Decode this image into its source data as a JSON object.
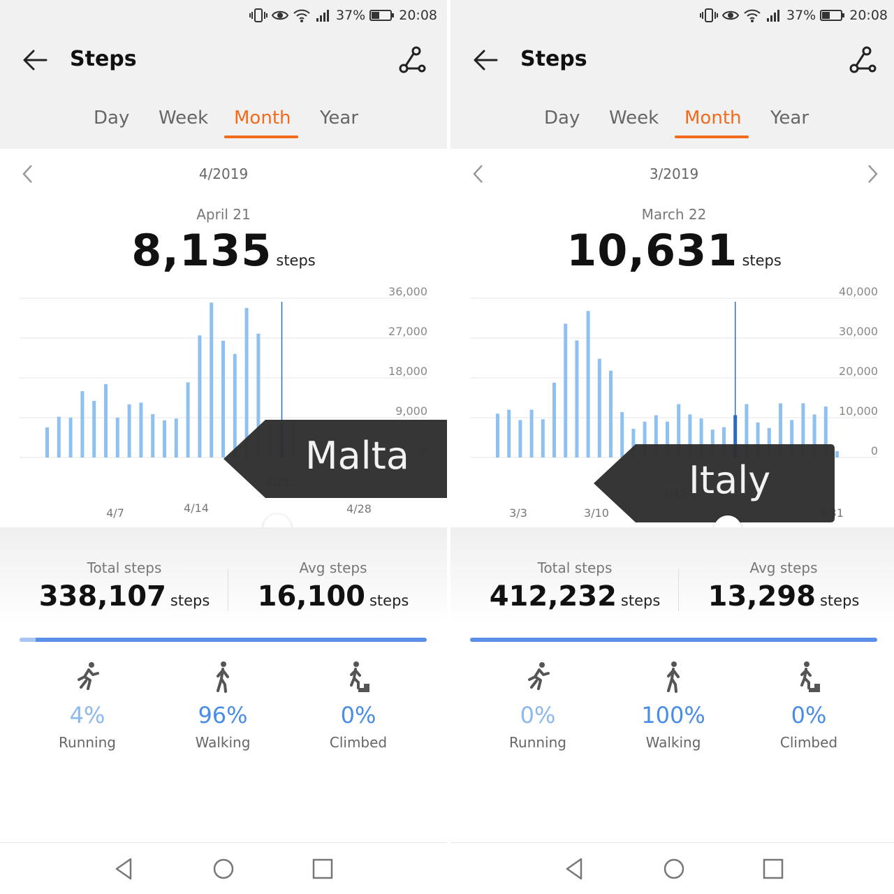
{
  "colors": {
    "accent": "#f26a1b",
    "bar": "#8ec0f2",
    "bar_selected": "#2a6cc2",
    "circle": "#f08c35",
    "ribbon": "#2f2f2f",
    "progress": "#5b8ee6",
    "pct_light": "#8cb8ee",
    "pct_strong": "#4a8de6"
  },
  "status_bar": {
    "battery": "37%",
    "time": "20:08",
    "icons": [
      "vibrate-icon",
      "eye-icon",
      "wifi-icon",
      "signal-icon",
      "battery-icon"
    ]
  },
  "panels": [
    {
      "header": {
        "title": "Steps",
        "back_icon": "back-arrow-icon",
        "route_icon": "route-icon"
      },
      "tabs": [
        {
          "label": "Day"
        },
        {
          "label": "Week"
        },
        {
          "label": "Month"
        },
        {
          "label": "Year"
        }
      ],
      "active_tab": "Month",
      "period": "4/2019",
      "has_next": false,
      "selected": {
        "date": "April 21",
        "value": "8,135",
        "unit": "steps"
      },
      "chart_data": {
        "type": "bar",
        "y_ticks": [
          "36,000",
          "27,000",
          "18,000",
          "9,000",
          "0"
        ],
        "ylim": [
          0,
          36000
        ],
        "x_tick_labels": [
          "4/7",
          "4/14",
          "4/21",
          "4/28"
        ],
        "selected_index": 20,
        "values": [
          6800,
          9200,
          9000,
          15000,
          12800,
          16600,
          9000,
          12000,
          12400,
          9800,
          8400,
          8800,
          17000,
          27600,
          35000,
          26400,
          23400,
          33800,
          28000,
          7400,
          7400,
          8135
        ],
        "series": [
          {
            "values": [
              6800,
              9200,
              9000,
              15000,
              12800,
              16600,
              9000,
              12000,
              12400,
              9800,
              8400,
              8800,
              17000,
              27600,
              35000,
              26400,
              23400,
              33800,
              28000,
              7400,
              7400,
              8135
            ]
          }
        ]
      },
      "annotation": "Malta",
      "totals": {
        "total_label": "Total steps",
        "total_value": "338,107",
        "avg_label": "Avg steps",
        "avg_value": "16,100",
        "unit": "steps"
      },
      "activities": [
        {
          "pct": "4%",
          "label": "Running",
          "icon": "running-icon"
        },
        {
          "pct": "96%",
          "label": "Walking",
          "icon": "walking-icon"
        },
        {
          "pct": "0%",
          "label": "Climbed",
          "icon": "climbing-icon"
        }
      ],
      "running_fraction": 0.04
    },
    {
      "header": {
        "title": "Steps",
        "back_icon": "back-arrow-icon",
        "route_icon": "route-icon"
      },
      "tabs": [
        {
          "label": "Day"
        },
        {
          "label": "Week"
        },
        {
          "label": "Month"
        },
        {
          "label": "Year"
        }
      ],
      "active_tab": "Month",
      "period": "3/2019",
      "has_next": true,
      "selected": {
        "date": "March 22",
        "value": "10,631",
        "unit": "steps"
      },
      "chart_data": {
        "type": "bar",
        "y_ticks": [
          "40,000",
          "30,000",
          "20,000",
          "10,000",
          "0"
        ],
        "ylim": [
          0,
          40000
        ],
        "x_tick_labels": [
          "3/3",
          "3/10",
          "3/17",
          "3/24",
          "3/31"
        ],
        "selected_index": 21,
        "values": [
          11000,
          12000,
          9400,
          12000,
          9600,
          18800,
          33600,
          29400,
          36800,
          24800,
          21800,
          11400,
          7200,
          9000,
          10600,
          9000,
          13400,
          10800,
          9800,
          7000,
          7600,
          10631,
          13400,
          8800,
          7400,
          13600,
          9400,
          13600,
          10800,
          12800,
          1600
        ],
        "series": [
          {
            "values": [
              11000,
              12000,
              9400,
              12000,
              9600,
              18800,
              33600,
              29400,
              36800,
              24800,
              21800,
              11400,
              7200,
              9000,
              10600,
              9000,
              13400,
              10800,
              9800,
              7000,
              7600,
              10631,
              13400,
              8800,
              7400,
              13600,
              9400,
              13600,
              10800,
              12800,
              1600
            ]
          }
        ]
      },
      "annotation": "Italy",
      "totals": {
        "total_label": "Total steps",
        "total_value": "412,232",
        "avg_label": "Avg steps",
        "avg_value": "13,298",
        "unit": "steps"
      },
      "activities": [
        {
          "pct": "0%",
          "label": "Running",
          "icon": "running-icon"
        },
        {
          "pct": "100%",
          "label": "Walking",
          "icon": "walking-icon"
        },
        {
          "pct": "0%",
          "label": "Climbed",
          "icon": "climbing-icon"
        }
      ],
      "running_fraction": 0.0
    }
  ],
  "nav_bar": {
    "icons": [
      "back-triangle-icon",
      "home-circle-icon",
      "recents-square-icon"
    ]
  }
}
